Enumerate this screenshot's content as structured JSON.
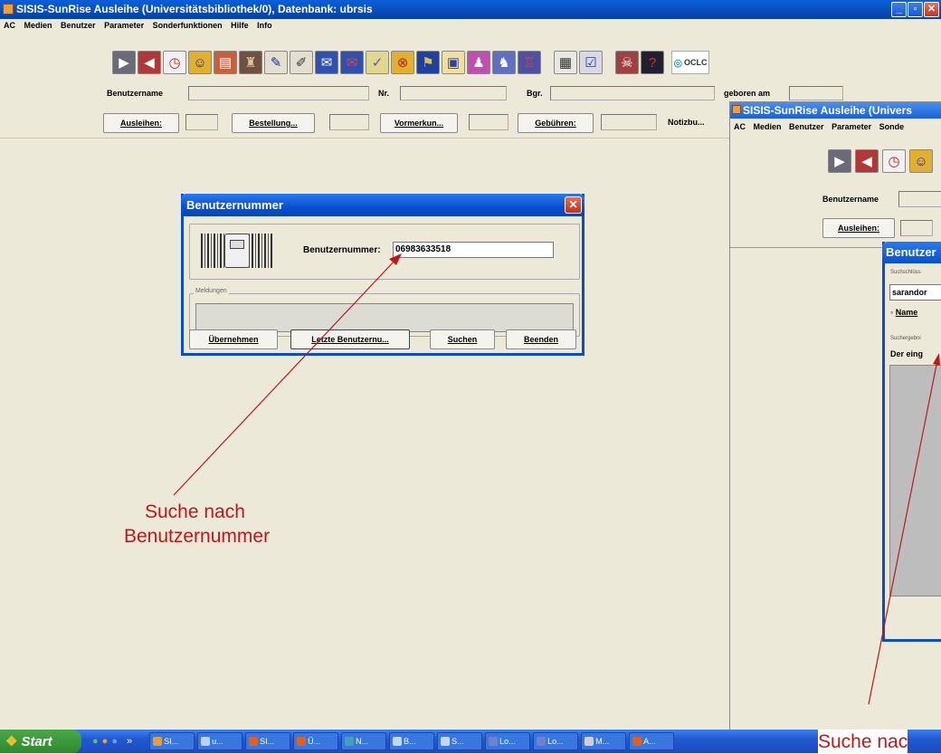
{
  "main_window": {
    "title": "SISIS-SunRise Ausleihe   (Universitätsbibliothek/0), Datenbank: ubrsis",
    "menu": [
      "AC",
      "Medien",
      "Benutzer",
      "Parameter",
      "Sonderfunktionen",
      "Hilfe",
      "Info"
    ],
    "toolbar_icons": [
      "tool-1-icon",
      "tool-2-icon",
      "tool-3-icon",
      "tool-4-icon",
      "tool-5-icon",
      "tool-6-icon",
      "tool-7-icon",
      "tool-8-icon",
      "tool-9-icon",
      "tool-10-icon",
      "tool-11-icon",
      "tool-12-icon",
      "tool-13-icon",
      "tool-14-icon",
      "tool-15-icon",
      "tool-16-icon",
      "tool-17-icon",
      "tool-18-icon",
      "tool-19-icon",
      "tool-20-icon",
      "tool-21-icon"
    ],
    "oclc_label": "OCLC",
    "fields": {
      "benutzername_label": "Benutzername",
      "nr_label": "Nr.",
      "bgr_label": "Bgr.",
      "geboren_label": "geboren am"
    },
    "buttons": {
      "ausleihen": "Ausleihen:",
      "bestellung": "Bestellung...",
      "vormerkun": "Vormerkun...",
      "gebuehren": "Gebühren:",
      "notizbu": "Notizbu..."
    }
  },
  "dialog": {
    "title": "Benutzernummer",
    "field_label": "Benutzernummer:",
    "field_value": "06983633518",
    "group_label": "Meldungen",
    "buttons": {
      "uebernehmen": "Übernehmen",
      "letzte": "Letzte Benutzernu...",
      "suchen": "Suchen",
      "beenden": "Beenden"
    }
  },
  "inset_window": {
    "title": "SISIS-SunRise Ausleihe  (Univers",
    "menu": [
      "AC",
      "Medien",
      "Benutzer",
      "Parameter",
      "Sonde"
    ],
    "benutzername_label": "Benutzername",
    "ausleihen": "Ausleihen:",
    "dialog_title": "Benutzer",
    "group1_label": "Suchschlüss",
    "search_value": "sarandor",
    "radio_label": "Name",
    "group2_label": "Suchergebni",
    "result_text": "Der eing"
  },
  "annotations": {
    "left": [
      "Suche nach",
      "Benutzernummer"
    ],
    "right": "Suche nac"
  },
  "taskbar": {
    "start": "Start",
    "items": [
      "SI...",
      "u...",
      "SI...",
      "Ü...",
      "N...",
      "B...",
      "S...",
      "Lo...",
      "Lo...",
      "M...",
      "A..."
    ]
  },
  "colors": {
    "titlebar": "#0a50d0",
    "annotation": "#c01818",
    "face": "#ece9d8"
  }
}
